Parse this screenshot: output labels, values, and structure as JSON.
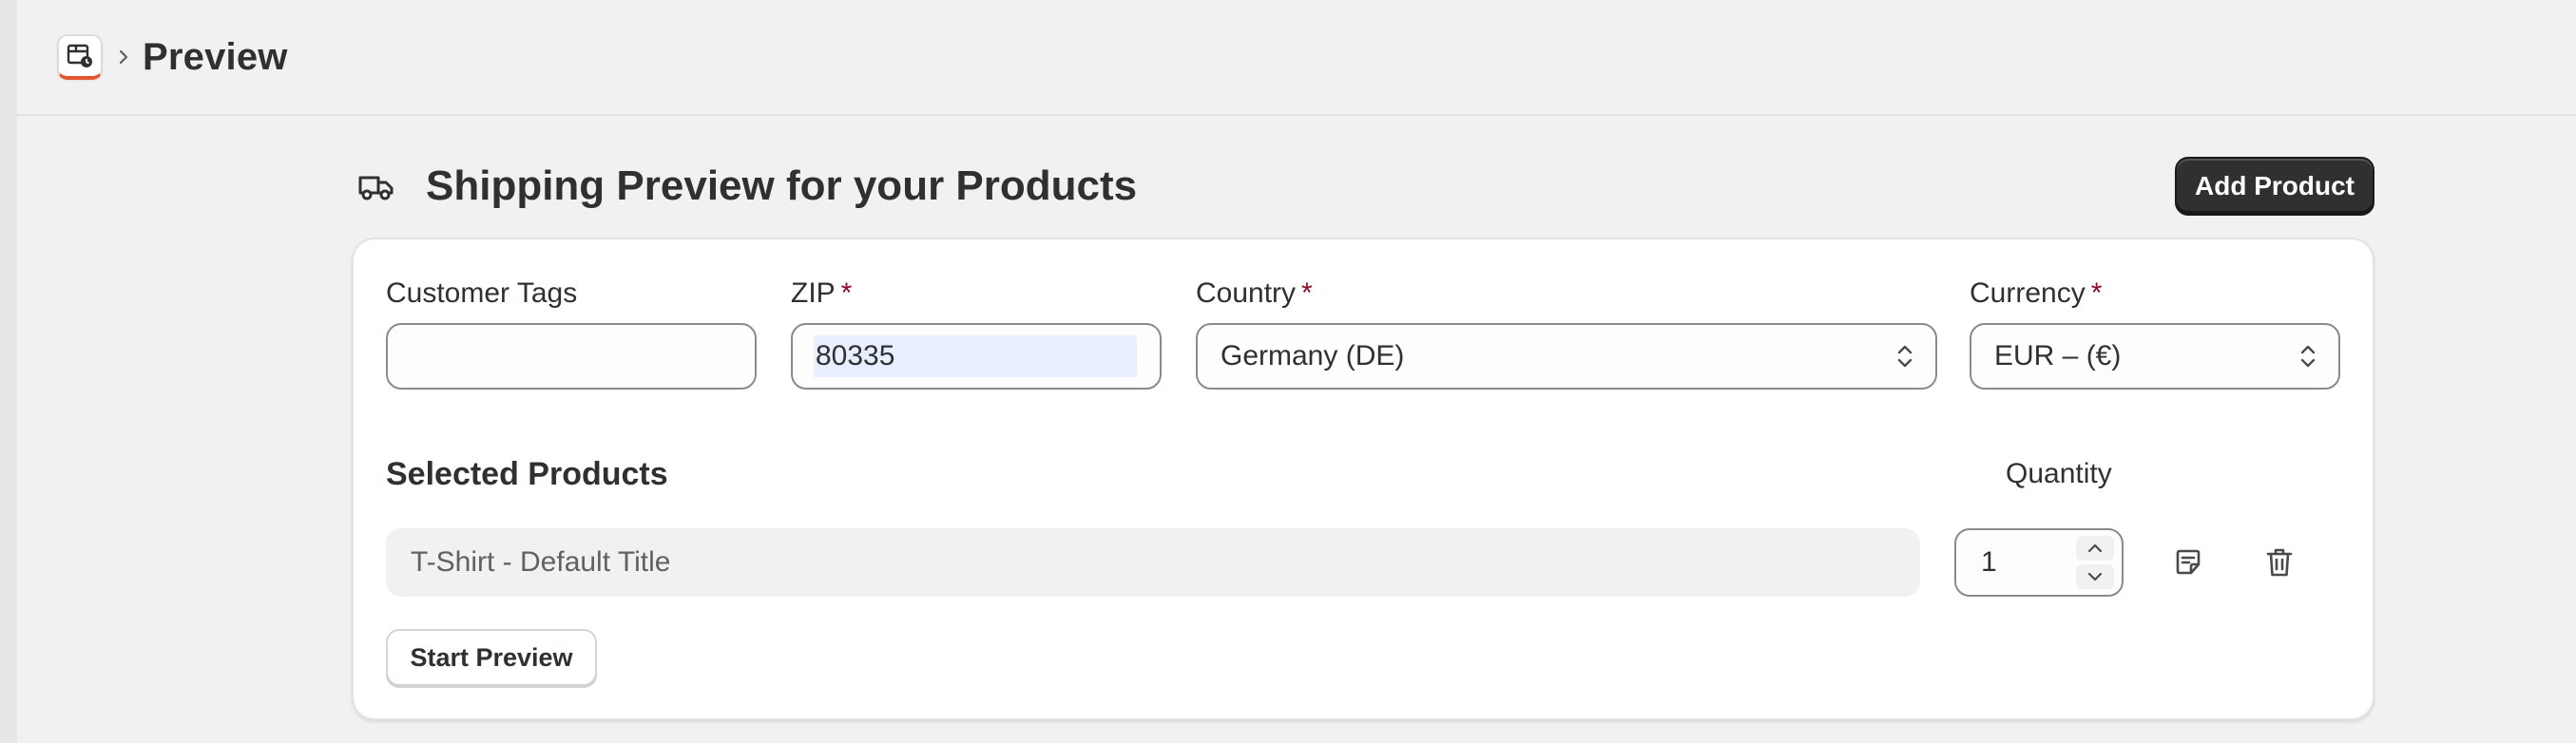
{
  "header": {
    "app_icon": "shipping-app-icon",
    "breadcrumb_separator": "chevron-right-icon",
    "page_title": "Preview"
  },
  "section": {
    "icon": "truck-icon",
    "title": "Shipping Preview for your Products",
    "add_product_label": "Add Product"
  },
  "form": {
    "customer_tags": {
      "label": "Customer Tags",
      "value": ""
    },
    "zip": {
      "label": "ZIP",
      "required_mark": "*",
      "value": "80335"
    },
    "country": {
      "label": "Country",
      "required_mark": "*",
      "value": "Germany (DE)"
    },
    "currency": {
      "label": "Currency",
      "required_mark": "*",
      "value": "EUR – (€)"
    }
  },
  "products": {
    "title": "Selected Products",
    "quantity_label": "Quantity",
    "items": [
      {
        "name": "T-Shirt - Default Title",
        "quantity": "1"
      }
    ]
  },
  "actions": {
    "start_preview_label": "Start Preview"
  },
  "colors": {
    "required": "#8e0b21",
    "primary_button": "#303030",
    "page_bg": "#f1f1f1",
    "zip_highlight": "#e8efff"
  }
}
